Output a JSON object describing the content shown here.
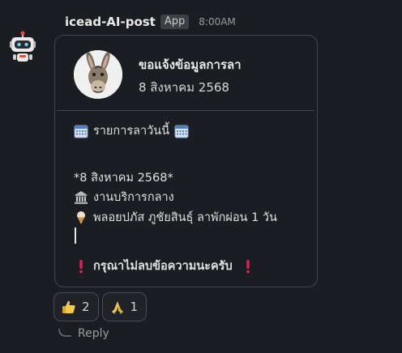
{
  "message": {
    "sender": "icead-AI-post",
    "badge": "App",
    "time": "8:00AM"
  },
  "card": {
    "title": "ขอแจ้งข้อมูลการลา",
    "subtitle": "8 สิงหาคม 2568",
    "heading": "รายการลาวันนี้",
    "date_line": "*8 สิงหาคม 2568*",
    "department": "งานบริการกลาง",
    "entry": "พลอยปภัส ภูชัยสินธุ์ ลาพักผ่อน 1 วัน",
    "warning": "กรุณาไม่ลบข้อความนะครับ"
  },
  "reactions": [
    {
      "emoji": "thumbs-up",
      "count": "2"
    },
    {
      "emoji": "folded-hands",
      "count": "1"
    }
  ],
  "reply_label": "Reply",
  "icons": {
    "calendar": "calendar-icon",
    "building": "classical-building-icon",
    "ice_cream": "ice-cream-icon",
    "exclamation": "red-exclamation-icon"
  },
  "colors": {
    "background": "#1a1d21",
    "border": "#45474b",
    "exclamation": "#e01e5a"
  }
}
